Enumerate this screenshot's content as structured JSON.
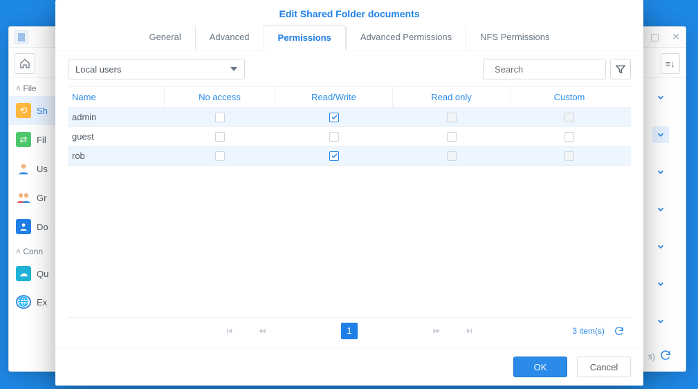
{
  "bg": {
    "nav_groups": {
      "file": "File",
      "conn": "Conn"
    },
    "nav": {
      "share": "Sh",
      "file": "Fil",
      "user": "Us",
      "group": "Gr",
      "domain": "Do",
      "quota": "Qu",
      "external": "Ex"
    },
    "status_items": "s)"
  },
  "dialog": {
    "title": "Edit Shared Folder documents",
    "tabs": {
      "general": "General",
      "advanced": "Advanced",
      "permissions": "Permissions",
      "adv_permissions": "Advanced Permissions",
      "nfs": "NFS Permissions"
    },
    "select": {
      "value": "Local users"
    },
    "search": {
      "placeholder": "Search"
    },
    "columns": {
      "name": "Name",
      "no_access": "No access",
      "read_write": "Read/Write",
      "read_only": "Read only",
      "custom": "Custom"
    },
    "rows": [
      {
        "name": "admin",
        "no_access": false,
        "read_write": true,
        "read_only": false,
        "custom": false,
        "ro_disabled": true,
        "custom_disabled": true
      },
      {
        "name": "guest",
        "no_access": false,
        "read_write": false,
        "read_only": false,
        "custom": false,
        "ro_disabled": false,
        "custom_disabled": false
      },
      {
        "name": "rob",
        "no_access": false,
        "read_write": true,
        "read_only": false,
        "custom": false,
        "ro_disabled": true,
        "custom_disabled": true
      }
    ],
    "pager": {
      "page": "1",
      "count_label": "3 item(s)"
    },
    "buttons": {
      "ok": "OK",
      "cancel": "Cancel"
    }
  }
}
